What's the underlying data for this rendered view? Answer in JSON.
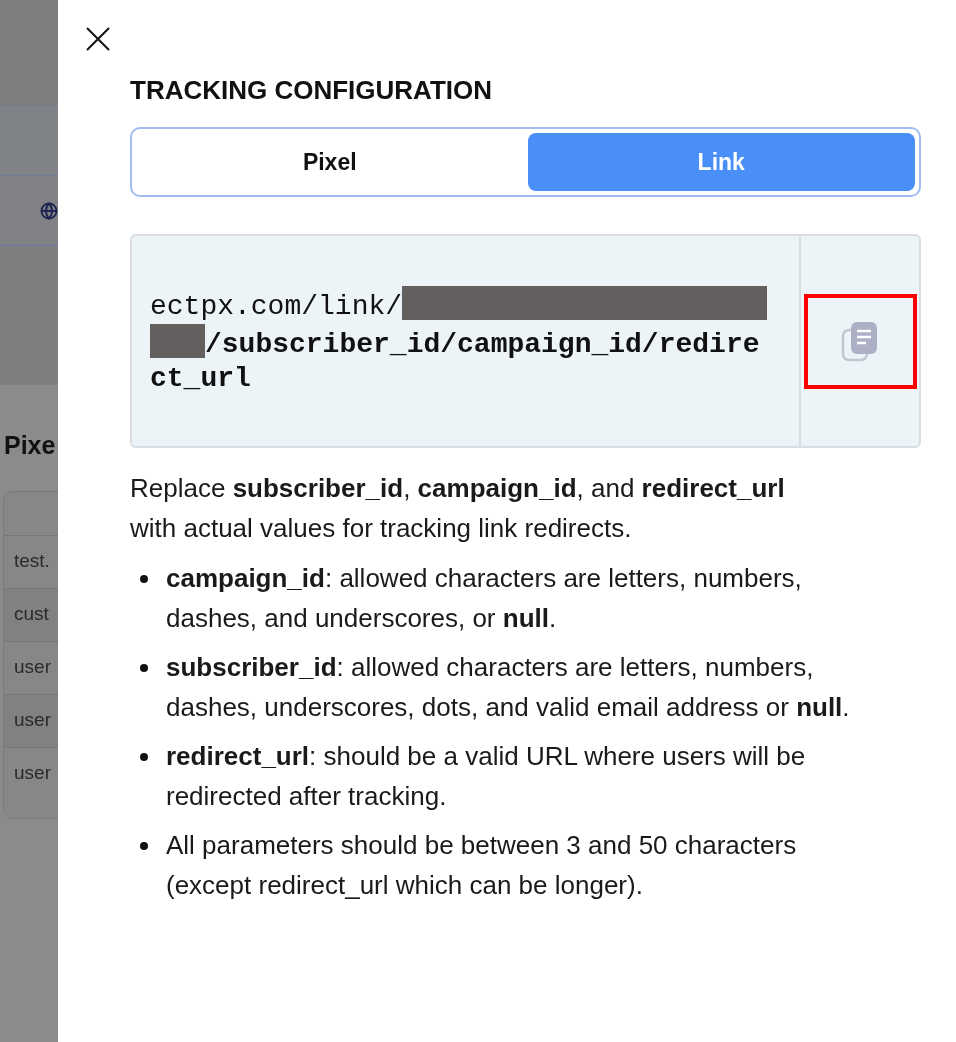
{
  "background": {
    "section_title": "Pixe",
    "table_rows": [
      "test.",
      "cust",
      "user",
      "user",
      "user"
    ]
  },
  "panel": {
    "title": "TRACKING CONFIGURATION",
    "tabs": [
      {
        "label": "Pixel",
        "selected": false
      },
      {
        "label": "Link",
        "selected": true
      }
    ],
    "code": {
      "prefix": "ectpx.com/link/",
      "redacted": true,
      "suffix": "/subscriber_id/campaign_id/redirect_url"
    },
    "copy_button": {
      "highlighted": true
    },
    "description": "Replace **subscriber_id**, **campaign_id**, and **redirect_url** with actual values for tracking link redirects.",
    "bullets": [
      "**campaign_id**: allowed characters are letters, numbers, dashes, and underscores, or **null**.",
      "**subscriber_id**: allowed characters are letters, numbers, dashes, underscores, dots, and valid email address or **null**.",
      "**redirect_url**: should be a valid URL where users will be redirected after tracking.",
      "All parameters should be between 3 and 50 characters (except redirect_url which can be longer)."
    ]
  }
}
